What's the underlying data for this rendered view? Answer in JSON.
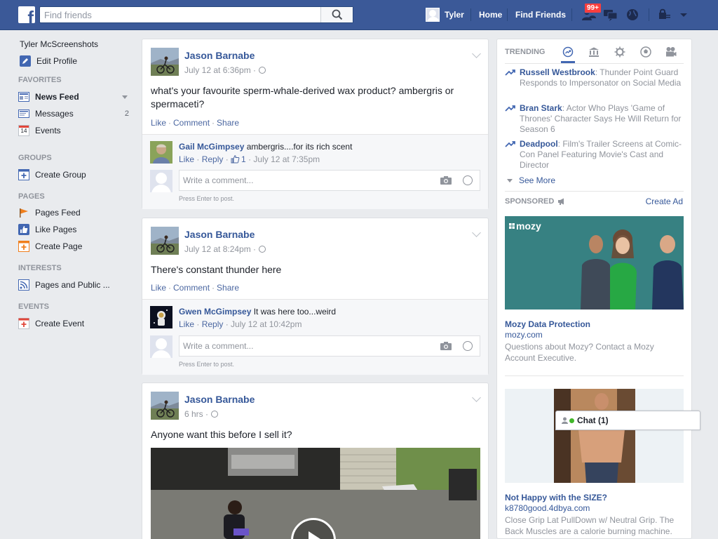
{
  "header": {
    "search_placeholder": "Find friends",
    "user_name": "Tyler",
    "home_label": "Home",
    "find_friends_label": "Find Friends",
    "notification_count": "99+"
  },
  "sidebar": {
    "profile_name": "Tyler McScreenshots",
    "edit_profile": "Edit Profile",
    "favorites_head": "FAVORITES",
    "news_feed": "News Feed",
    "messages": "Messages",
    "messages_count": "2",
    "events": "Events",
    "events_icon_num": "14",
    "groups_head": "GROUPS",
    "create_group": "Create Group",
    "pages_head": "PAGES",
    "pages_feed": "Pages Feed",
    "like_pages": "Like Pages",
    "create_page": "Create Page",
    "interests_head": "INTERESTS",
    "pages_public": "Pages and Public ...",
    "events_head": "EVENTS",
    "create_event": "Create Event"
  },
  "posts": [
    {
      "author": "Jason Barnabe",
      "time": "July 12 at 6:36pm ·",
      "text": "what's your favourite sperm-whale-derived wax product? ambergris or spermaceti?",
      "actions": {
        "like": "Like",
        "comment": "Comment",
        "share": "Share"
      },
      "comment": {
        "author": "Gail McGimpsey",
        "text": "ambergris....for its rich scent",
        "like": "Like",
        "reply": "Reply",
        "likes": "1",
        "time": "July 12 at 7:35pm"
      },
      "write_placeholder": "Write a comment...",
      "press_enter": "Press Enter to post."
    },
    {
      "author": "Jason Barnabe",
      "time": "July 12 at 8:24pm ·",
      "text": "There's constant thunder here",
      "actions": {
        "like": "Like",
        "comment": "Comment",
        "share": "Share"
      },
      "comment": {
        "author": "Gwen McGimpsey",
        "text": "It was here too...weird",
        "like": "Like",
        "reply": "Reply",
        "time": "July 12 at 10:42pm"
      },
      "write_placeholder": "Write a comment...",
      "press_enter": "Press Enter to post."
    },
    {
      "author": "Jason Barnabe",
      "time": "6 hrs ·",
      "text": "Anyone want this before I sell it?"
    }
  ],
  "trending": {
    "head": "TRENDING",
    "items": [
      {
        "name": "Russell Westbrook",
        "text": "Thunder Point Guard Responds to Impersonator on Social Media"
      },
      {
        "name": "Bran Stark",
        "text": "Actor Who Plays 'Game of Thrones' Character Says He Will Return for Season 6"
      },
      {
        "name": "Deadpool",
        "text": "Film's Trailer Screens at Comic-Con Panel Featuring Movie's Cast and Director"
      }
    ],
    "see_more": "See More"
  },
  "sponsored": {
    "head": "SPONSORED",
    "create_ad": "Create Ad",
    "ads": [
      {
        "logo": "mozy",
        "title": "Mozy Data Protection",
        "url": "mozy.com",
        "desc": "Questions about Mozy? Contact a Mozy Account Executive."
      },
      {
        "title": "Not Happy with the SIZE?",
        "url": "k8780good.4dbya.com",
        "desc": "Close Grip Lat PullDown w/ Neutral Grip. The Back Muscles are a calorie burning machine."
      }
    ]
  },
  "chat": {
    "label": "Chat (1)"
  },
  "colors": {
    "brand": "#3b5998",
    "link": "#365899",
    "badge": "#fa3e3e",
    "online": "#42b72a"
  }
}
